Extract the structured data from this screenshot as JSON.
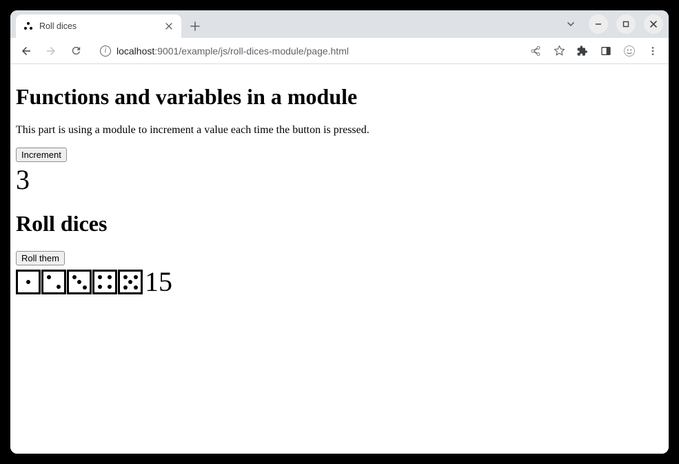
{
  "browser": {
    "tab_title": "Roll dices",
    "url_host": "localhost",
    "url_port": ":9001",
    "url_path": "/example/js/roll-dices-module/page.html"
  },
  "page": {
    "heading1": "Functions and variables in a module",
    "intro": "This part is using a module to increment a value each time the button is pressed.",
    "increment_button": "Increment",
    "counter_value": "3",
    "heading2": "Roll dices",
    "roll_button": "Roll them",
    "dice": [
      1,
      2,
      3,
      4,
      5
    ],
    "dice_sum": "15"
  }
}
